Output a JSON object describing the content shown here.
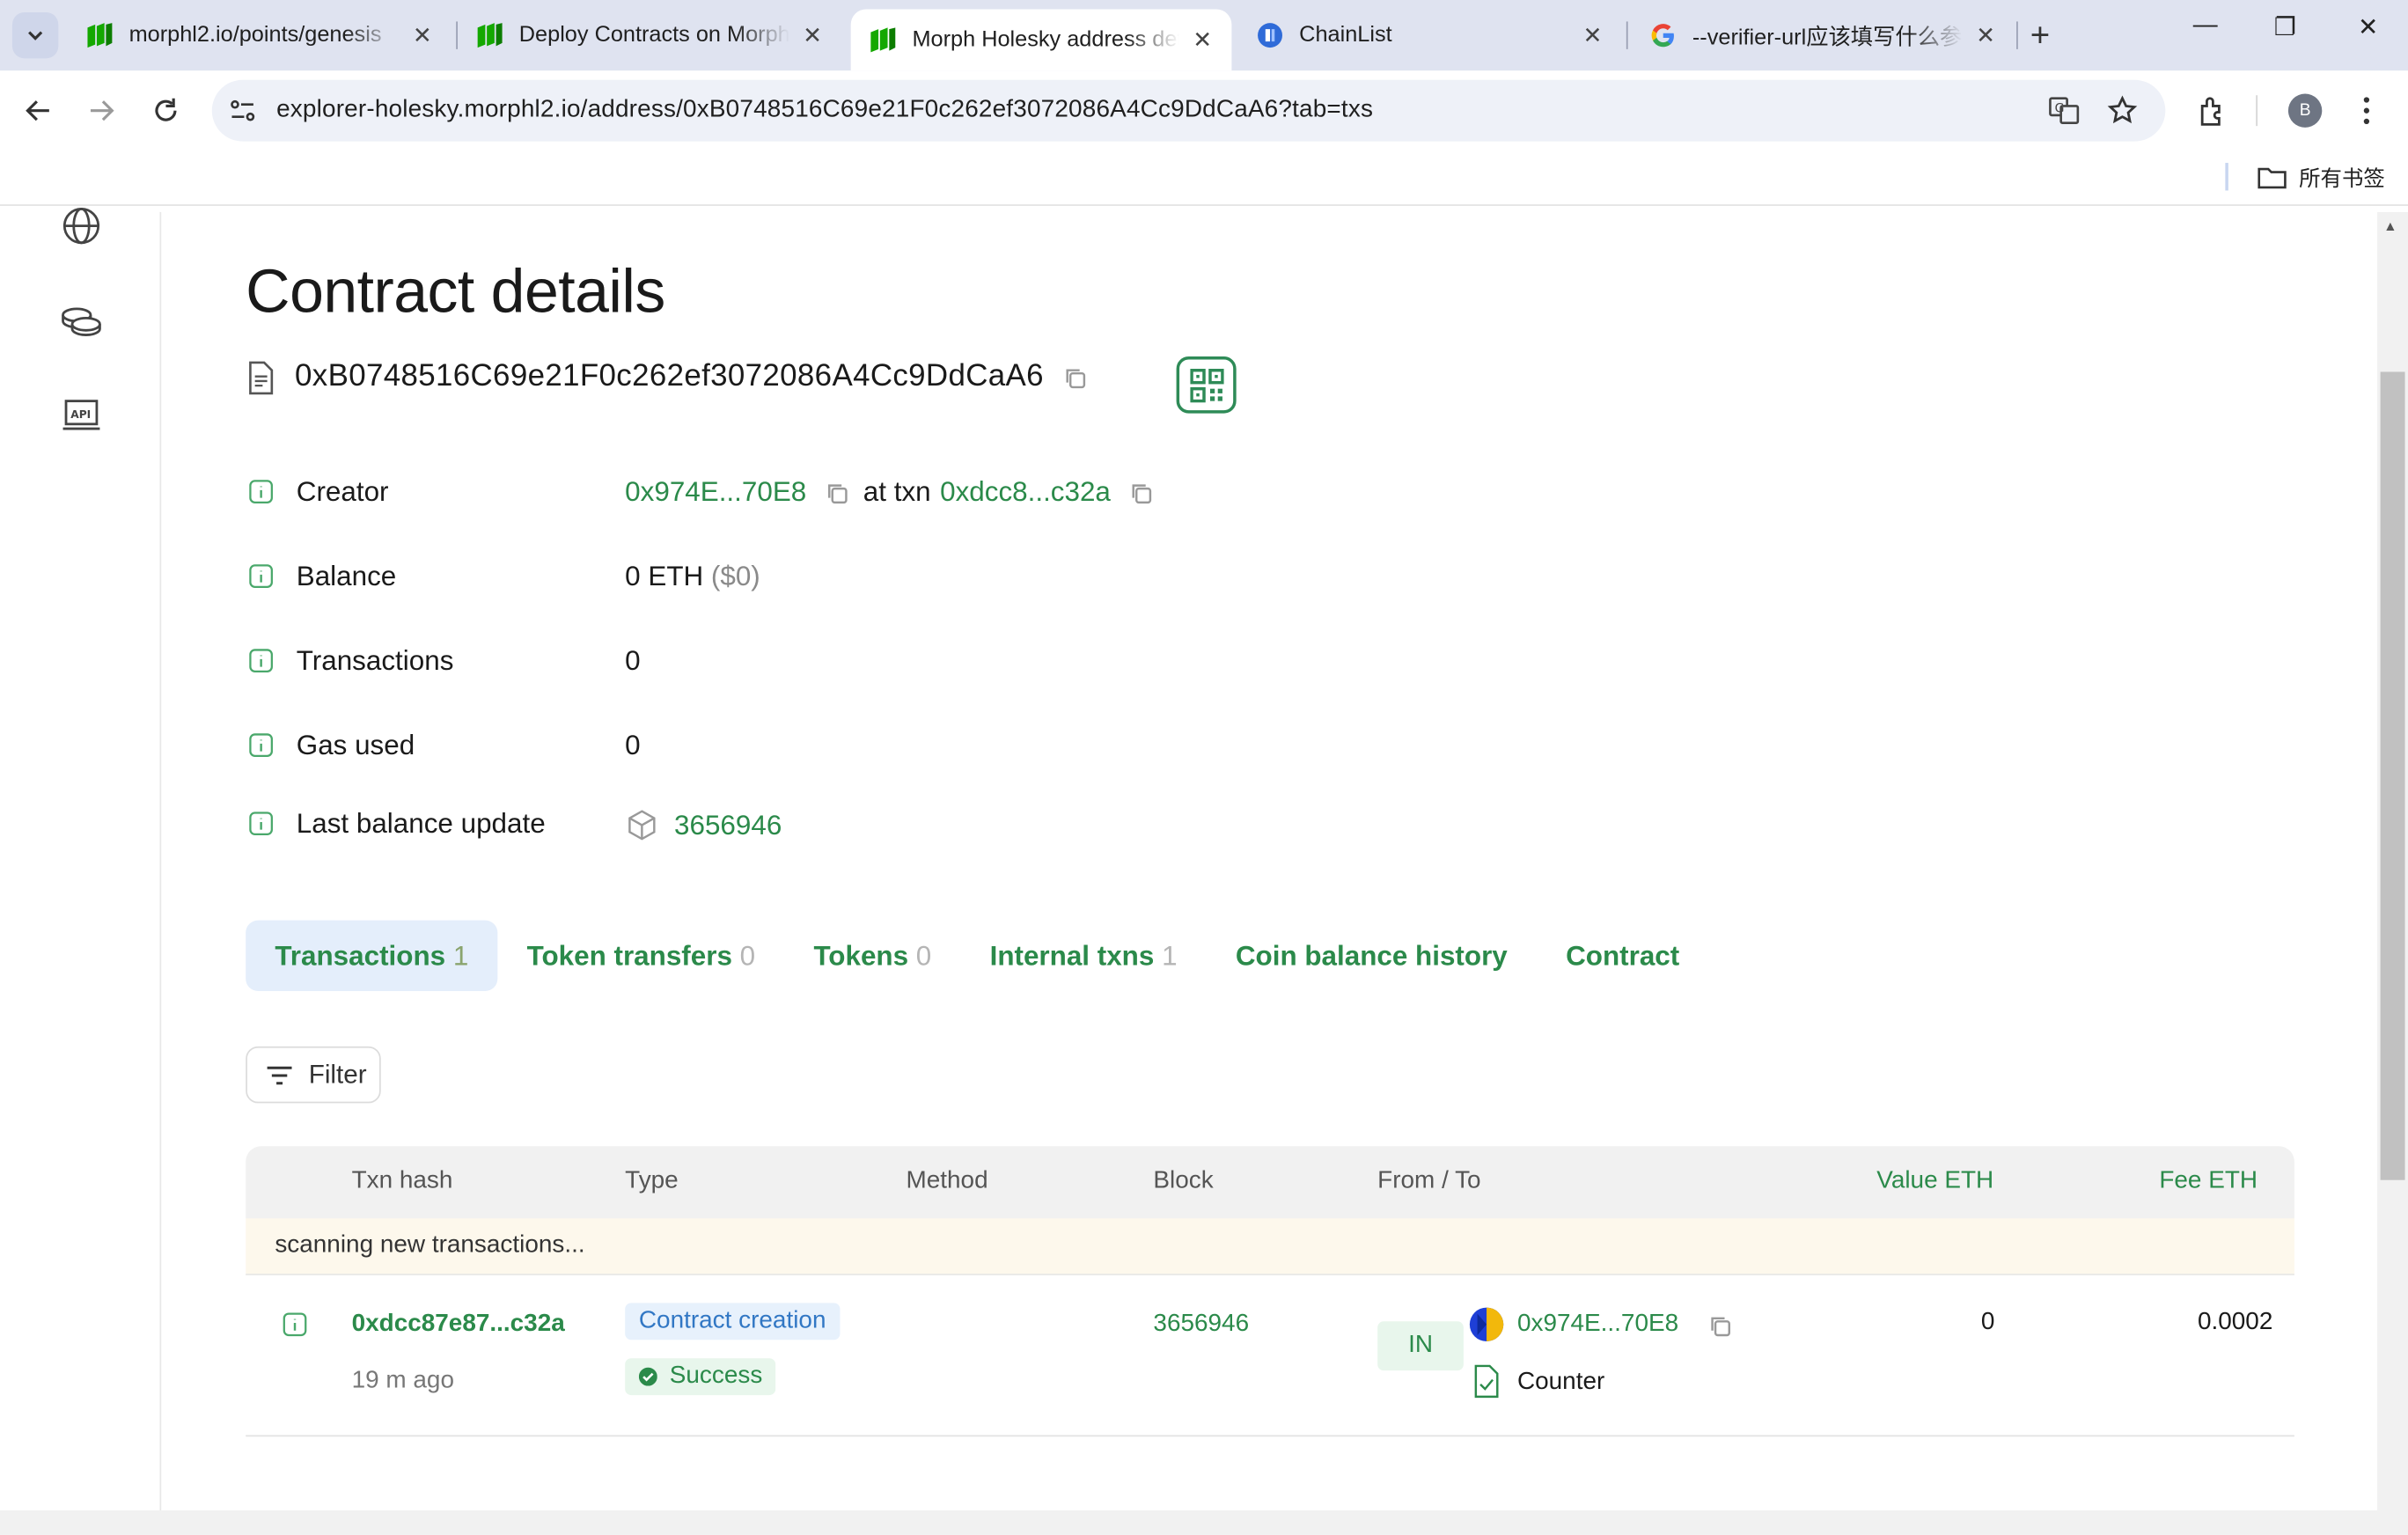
{
  "browser": {
    "tabs": [
      {
        "title": "morphl2.io/points/genesis",
        "favicon": "morph-logo"
      },
      {
        "title": "Deploy Contracts on Morph",
        "favicon": "morph-logo"
      },
      {
        "title": "Morph Holesky address details",
        "favicon": "morph-logo",
        "active": true
      },
      {
        "title": "ChainList",
        "favicon": "chainlist-logo"
      },
      {
        "title": "--verifier-url应该填写什么参数",
        "favicon": "google-logo"
      }
    ],
    "close_glyph": "✕",
    "new_tab_glyph": "+",
    "url": "explorer-holesky.morphl2.io/address/0xB0748516C69e21F0c262ef3072086A4Cc9DdCaA6?tab=txs",
    "profile_initial": "B",
    "bookmarks_label": "所有书签",
    "window_controls": [
      "—",
      "❐",
      "✕"
    ]
  },
  "page": {
    "title": "Contract details",
    "address": "0xB0748516C69e21F0c262ef3072086A4Cc9DdCaA6",
    "details": {
      "creator_label": "Creator",
      "creator_address": "0x974E...70E8",
      "at_txn_label": "at txn",
      "creator_txn": "0xdcc8...c32a",
      "balance_label": "Balance",
      "balance_value": "0 ETH",
      "balance_usd": "($0)",
      "transactions_label": "Transactions",
      "transactions_value": "0",
      "gas_label": "Gas used",
      "gas_value": "0",
      "last_update_label": "Last balance update",
      "last_update_block": "3656946"
    },
    "tabs": [
      {
        "label": "Transactions",
        "count": "1",
        "active": true
      },
      {
        "label": "Token transfers",
        "count": "0"
      },
      {
        "label": "Tokens",
        "count": "0"
      },
      {
        "label": "Internal txns",
        "count": "1"
      },
      {
        "label": "Coin balance history",
        "count": ""
      },
      {
        "label": "Contract",
        "count": ""
      }
    ],
    "filter_label": "Filter",
    "table": {
      "headers": [
        "Txn hash",
        "Type",
        "Method",
        "Block",
        "From / To",
        "Value ETH",
        "Fee ETH"
      ],
      "scanning_text": "scanning new transactions...",
      "rows": [
        {
          "hash": "0xdcc87e87...c32a",
          "age": "19 m ago",
          "type": "Contract creation",
          "status": "Success",
          "method": "",
          "block": "3656946",
          "direction": "IN",
          "from": "0x974E...70E8",
          "to": "Counter",
          "value": "0",
          "fee": "0.0002"
        }
      ]
    }
  },
  "colors": {
    "accent_green": "#2b8a4a",
    "tab_active_bg": "#e4eefb",
    "scan_bg": "#fdf8ec"
  }
}
